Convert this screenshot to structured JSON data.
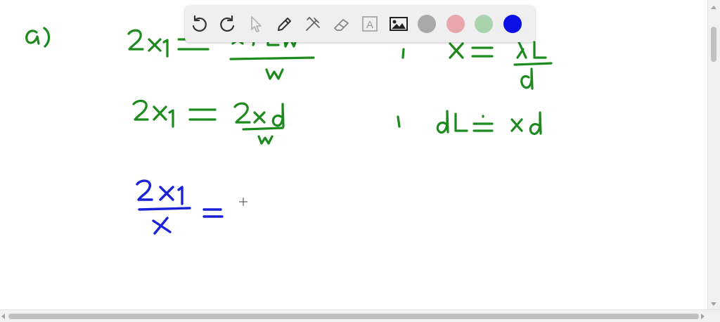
{
  "toolbar": {
    "tools": [
      {
        "icon": "undo-icon"
      },
      {
        "icon": "redo-icon"
      },
      {
        "icon": "pointer-icon"
      },
      {
        "icon": "pen-icon"
      },
      {
        "icon": "tools-icon"
      },
      {
        "icon": "eraser-icon"
      },
      {
        "icon": "text-icon",
        "glyph": "A"
      },
      {
        "icon": "image-icon"
      }
    ],
    "colors": [
      {
        "name": "gray",
        "hex": "#a8a8a8"
      },
      {
        "name": "pink",
        "hex": "#e8a6ad"
      },
      {
        "name": "green",
        "hex": "#a9d3ad"
      },
      {
        "name": "blue",
        "hex": "#0a10e6"
      }
    ]
  },
  "ink": {
    "green": "#1c8a1c",
    "blue": "#1a22d6"
  }
}
